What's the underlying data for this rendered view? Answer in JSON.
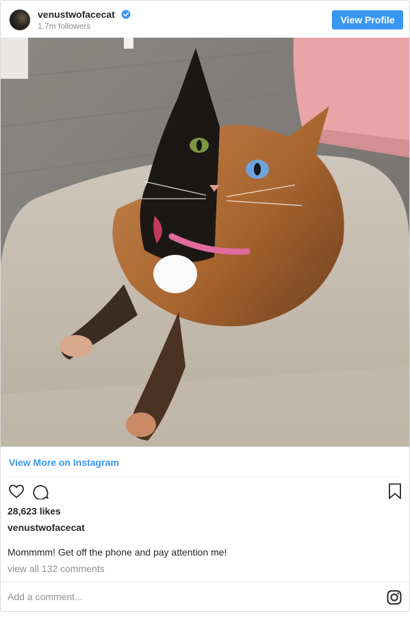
{
  "header": {
    "username": "venustwofacecat",
    "followers": "1.7m followers",
    "view_profile_label": "View Profile"
  },
  "post": {
    "view_more_label": "View More on Instagram",
    "likes": "28,623 likes",
    "caption_username": "venustwofacecat",
    "caption": "Mommmm! Get off the phone and pay attention me!",
    "comments_link": "view all 132 comments"
  },
  "comment_box": {
    "placeholder": "Add a comment..."
  },
  "icons": {
    "verified": "verified-badge-icon",
    "like": "heart-icon",
    "comment": "comment-bubble-icon",
    "save": "bookmark-icon",
    "brand": "instagram-logo-icon"
  },
  "colors": {
    "accent": "#3897f0",
    "text": "#262626",
    "muted": "#8e8e8e",
    "border": "#dbdbdb"
  }
}
